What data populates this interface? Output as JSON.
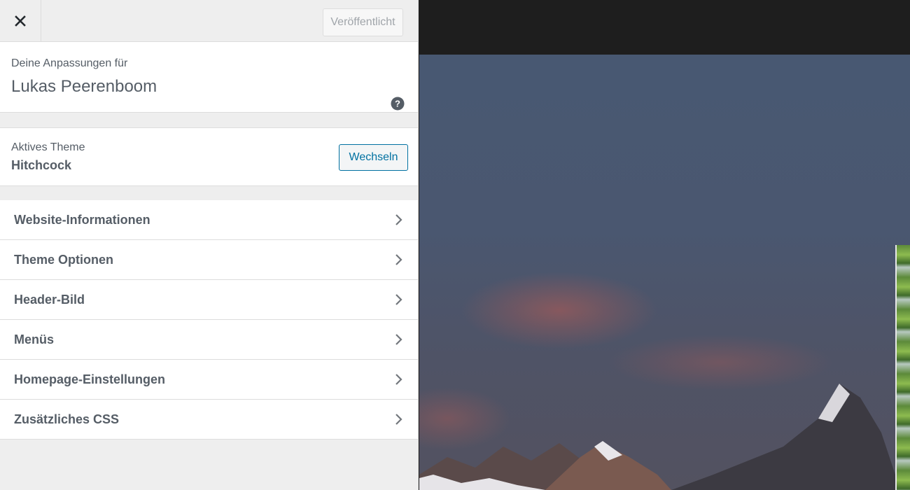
{
  "header": {
    "close_icon": "close-icon",
    "publish_label": "Veröffentlicht"
  },
  "info": {
    "label": "Deine Anpassungen für",
    "site_name": "Lukas Peerenboom",
    "help_icon": "question-icon"
  },
  "theme": {
    "label": "Aktives Theme",
    "name": "Hitchcock",
    "change_label": "Wechseln"
  },
  "menu": {
    "items": [
      {
        "label": "Website-Informationen"
      },
      {
        "label": "Theme Optionen"
      },
      {
        "label": "Header-Bild"
      },
      {
        "label": "Menüs"
      },
      {
        "label": "Homepage-Einstellungen"
      },
      {
        "label": "Zusätzliches CSS"
      }
    ]
  },
  "colors": {
    "accent": "#0071a1",
    "text": "#555d66",
    "sidebar_bg": "#eeeeee",
    "preview_bg": "#1e1e1e"
  }
}
